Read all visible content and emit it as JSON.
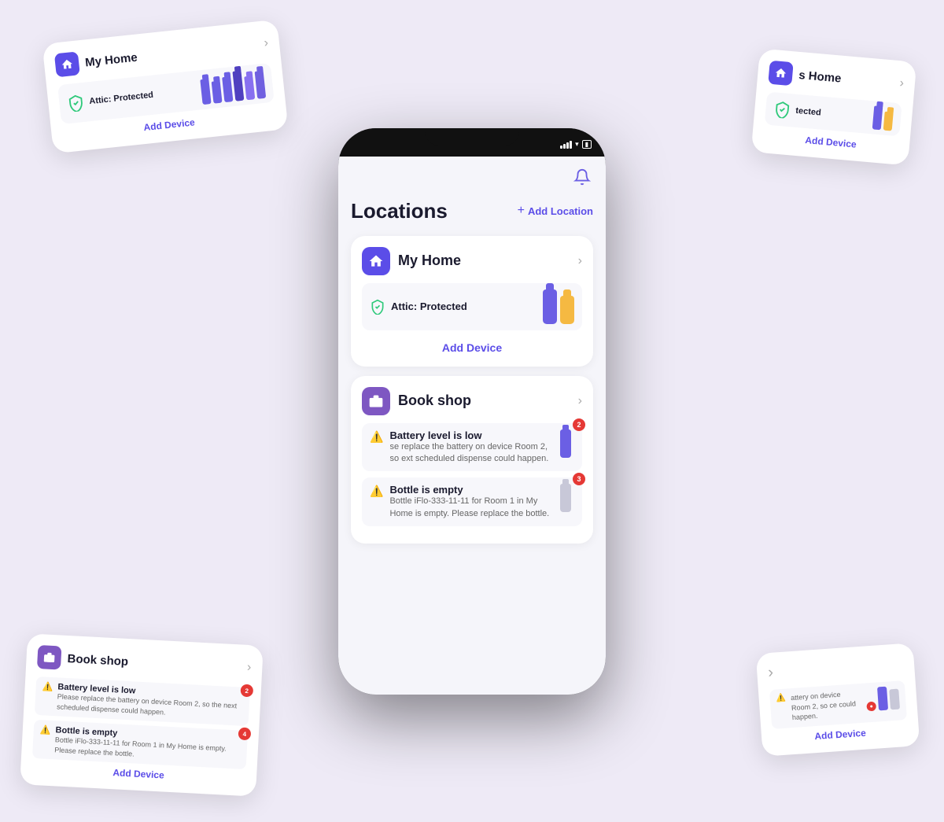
{
  "app": {
    "background": "#eeeaf6"
  },
  "phone": {
    "statusBar": {
      "signal": "signal",
      "wifi": "wifi",
      "battery": "battery"
    },
    "bell": "🔔",
    "header": {
      "title": "Locations",
      "addButton": "Add Location"
    },
    "cards": [
      {
        "id": "my-home",
        "name": "My Home",
        "iconType": "home",
        "status": "Attic: Protected",
        "statusColor": "#2ec97a",
        "addDevice": "Add Device",
        "alerts": [],
        "devices": [
          "purple",
          "yellow"
        ]
      },
      {
        "id": "book-shop",
        "name": "Book shop",
        "iconType": "shop",
        "addDevice": "Add Device",
        "alerts": [
          {
            "title": "Battery level is low",
            "body": "se replace the battery on device Room 2, so\next scheduled dispense could happen.",
            "badge": 2,
            "icon": "⚠️"
          },
          {
            "title": "Bottle is empty",
            "body": "Bottle iFlo-333-11-11 for Room 1 in My Home is\nempty. Please replace the bottle.",
            "badge": 3,
            "icon": "⚠️"
          }
        ],
        "devices": [
          "purple"
        ]
      }
    ]
  },
  "floatCards": {
    "topLeft": {
      "name": "My Home",
      "iconType": "home",
      "status": "Attic: Protected",
      "statusColor": "#2ec97a",
      "addDevice": "Add Device",
      "devices": [
        "purple",
        "purple",
        "purple",
        "purple",
        "purple",
        "purple"
      ]
    },
    "topRight": {
      "name": "s Home",
      "iconType": "home",
      "status": "tected",
      "addDevice": "Add Device",
      "devices": [
        "purple",
        "yellow"
      ]
    },
    "bottomLeft": {
      "name": "Book shop",
      "iconType": "shop",
      "addDevice": "Add Device",
      "alerts": [
        {
          "title": "Battery level is low",
          "body": "Please replace the battery on device Room 2, so\nthe next scheduled dispense could happen.",
          "badge": 2,
          "icon": "⚠️"
        },
        {
          "title": "Bottle is empty",
          "body": "Bottle iFlo-333-11-11 for Room 1 in My Home is\nempty. Please replace the bottle.",
          "badge": 4,
          "icon": "⚠️"
        }
      ],
      "devices": [
        "purple"
      ]
    },
    "bottomRight": {
      "name": "",
      "addDevice": "Add Device",
      "alerts": [
        {
          "title": "",
          "body": "attery on device Room 2, so\nce could happen.",
          "icon": "⚠️"
        }
      ],
      "devices": [
        "purple",
        "gray"
      ]
    }
  },
  "icons": {
    "home": "home",
    "shop": "shop",
    "chevron": "›",
    "bell": "🔔",
    "plus": "+",
    "shield": "shield",
    "warning": "⚠️"
  }
}
